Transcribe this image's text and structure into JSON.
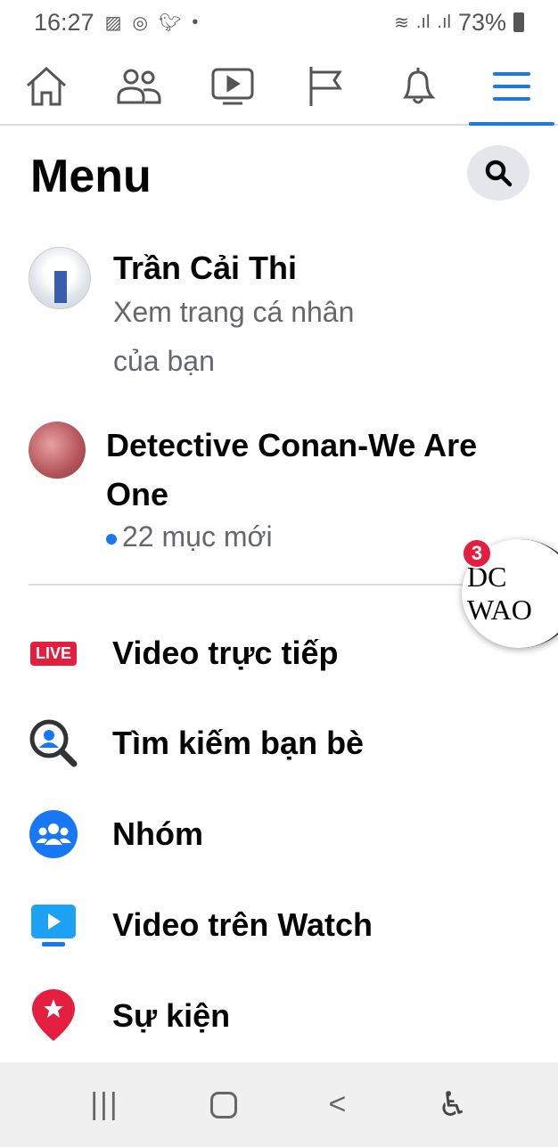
{
  "status": {
    "time": "16:27",
    "battery": "73%",
    "icons": [
      "gallery-icon",
      "messenger-icon",
      "twitter-icon",
      "dot-icon"
    ],
    "right_icons": [
      "wifi-icon",
      "signal-icon",
      "signal-icon",
      "battery-icon"
    ]
  },
  "nav": {
    "tabs": [
      "home",
      "friends",
      "watch",
      "pages",
      "notifications",
      "menu"
    ],
    "active": "menu",
    "accent": "#1877f2"
  },
  "menu": {
    "title": "Menu"
  },
  "profile": {
    "name": "Trần Cải Thi",
    "sub1": "Xem trang cá nhân",
    "sub2": "của bạn"
  },
  "group": {
    "name1": "Detective Conan-We Are",
    "name2": "One",
    "new": "22 mục mới"
  },
  "chathead": {
    "badge": "3",
    "label": "DC WAO"
  },
  "items": [
    {
      "label": "Video trực tiếp",
      "icon": "live-icon",
      "icon_text": "LIVE"
    },
    {
      "label": "Tìm kiếm bạn bè",
      "icon": "find-friends-icon"
    },
    {
      "label": "Nhóm",
      "icon": "groups-icon"
    },
    {
      "label": "Video trên Watch",
      "icon": "watch-icon"
    },
    {
      "label": "Sự kiện",
      "icon": "events-icon"
    }
  ],
  "sysnav": {
    "recents": "|||",
    "home": "○",
    "back": "<"
  }
}
